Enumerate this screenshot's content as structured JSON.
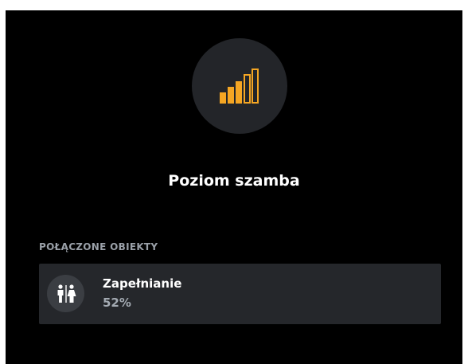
{
  "header": {
    "icon": "signal-level-icon",
    "title": "Poziom szamba",
    "level_active_bars": 3,
    "level_total_bars": 5
  },
  "section": {
    "label": "POŁĄCZONE OBIEKTY"
  },
  "objects": [
    {
      "icon": "restroom-icon",
      "name": "Zapełnianie",
      "value": "52%"
    }
  ],
  "colors": {
    "accent": "#f5a623",
    "background": "#000000",
    "card": "#25272b"
  }
}
